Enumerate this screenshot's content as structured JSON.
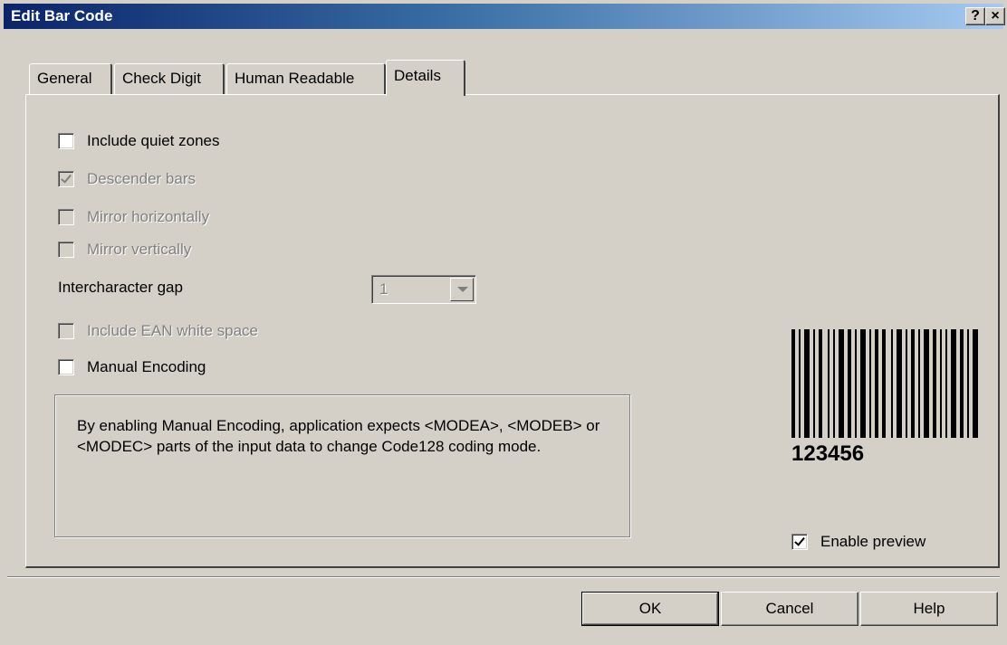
{
  "window": {
    "title": "Edit Bar Code",
    "help_button": "?",
    "close_button": "×"
  },
  "tabs": [
    {
      "label": "General",
      "active": false
    },
    {
      "label": "Check Digit",
      "active": false
    },
    {
      "label": "Human Readable",
      "active": false
    },
    {
      "label": "Details",
      "active": true
    }
  ],
  "details": {
    "include_quiet_zones": {
      "label": "Include quiet zones",
      "checked": false,
      "enabled": true
    },
    "descender_bars": {
      "label": "Descender bars",
      "checked": true,
      "enabled": false
    },
    "mirror_horizontally": {
      "label": "Mirror horizontally",
      "checked": false,
      "enabled": false
    },
    "mirror_vertically": {
      "label": "Mirror vertically",
      "checked": false,
      "enabled": false
    },
    "intercharacter_gap": {
      "label": "Intercharacter gap",
      "value": "1",
      "enabled": false
    },
    "include_ean_white_space": {
      "label": "Include EAN white space",
      "checked": false,
      "enabled": false
    },
    "manual_encoding": {
      "label": "Manual Encoding",
      "checked": false,
      "enabled": true
    },
    "info_text": "By enabling Manual Encoding, application expects <MODEA>, <MODEB> or <MODEC> parts of the input data to change Code128 coding mode."
  },
  "preview": {
    "barcode_text": "123456",
    "enable_preview": {
      "label": "Enable preview",
      "checked": true
    }
  },
  "buttons": {
    "ok": "OK",
    "cancel": "Cancel",
    "help": "Help"
  }
}
